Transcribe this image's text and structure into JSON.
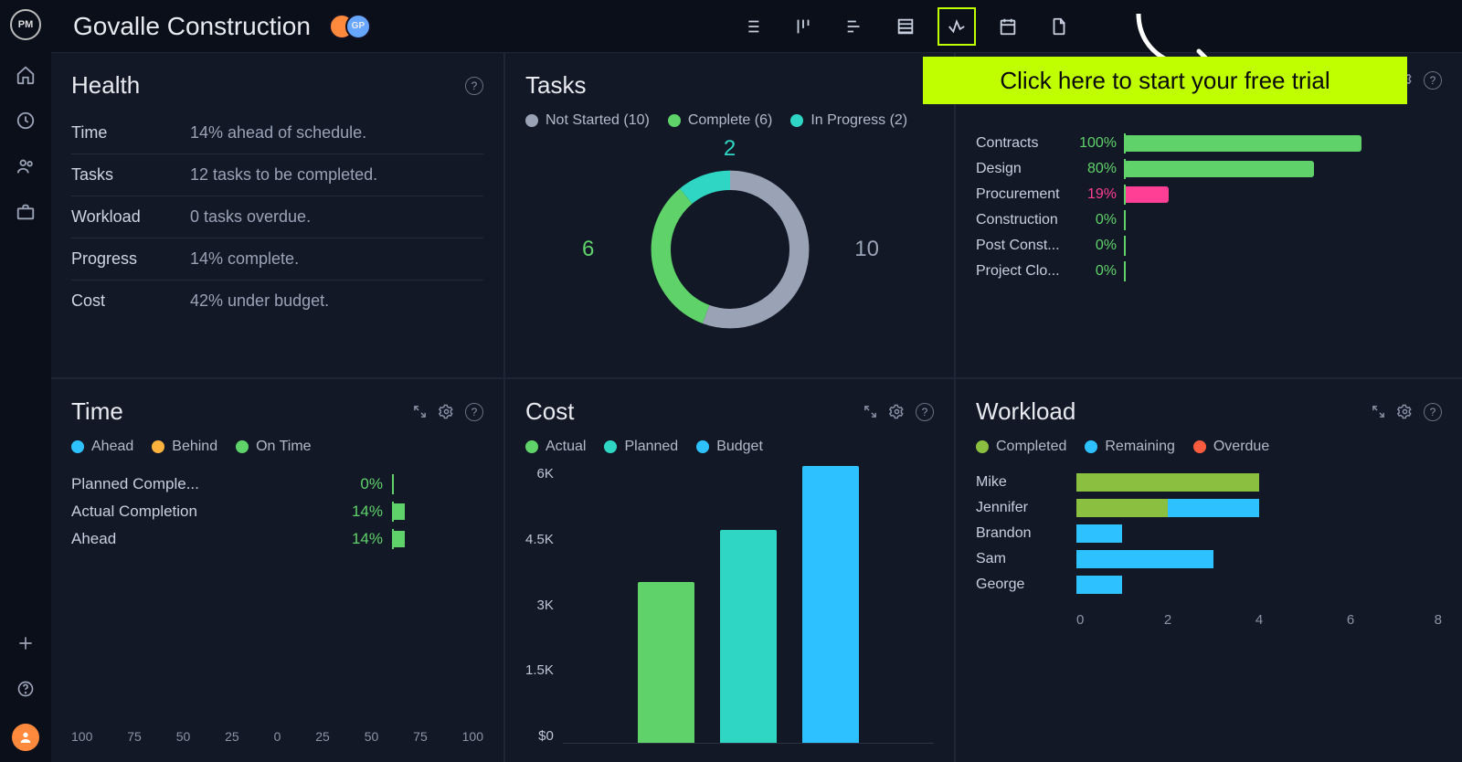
{
  "project_title": "Govalle Construction",
  "avatar_badge": "GP",
  "rail_logo": "PM",
  "cta_text": "Click here to start your free trial",
  "panels": {
    "health": {
      "title": "Health",
      "rows": [
        {
          "label": "Time",
          "value": "14% ahead of schedule."
        },
        {
          "label": "Tasks",
          "value": "12 tasks to be completed."
        },
        {
          "label": "Workload",
          "value": "0 tasks overdue."
        },
        {
          "label": "Progress",
          "value": "14% complete."
        },
        {
          "label": "Cost",
          "value": "42% under budget."
        }
      ]
    },
    "tasks": {
      "title": "Tasks",
      "legend": [
        {
          "color": "#9aa3b5",
          "label": "Not Started (10)"
        },
        {
          "color": "#5fd36a",
          "label": "Complete (6)"
        },
        {
          "color": "#2fd6c4",
          "label": "In Progress (2)"
        }
      ],
      "labels": {
        "top": "2",
        "left": "6",
        "right": "10"
      }
    },
    "progress": {
      "rows": [
        {
          "label": "Contracts",
          "pct": "100%",
          "width": 100,
          "color": "#5fd36a"
        },
        {
          "label": "Design",
          "pct": "80%",
          "width": 80,
          "color": "#5fd36a"
        },
        {
          "label": "Procurement",
          "pct": "19%",
          "width": 19,
          "color": "#ff3f95"
        },
        {
          "label": "Construction",
          "pct": "0%",
          "width": 0,
          "color": "#5fd36a"
        },
        {
          "label": "Post Const...",
          "pct": "0%",
          "width": 0,
          "color": "#5fd36a"
        },
        {
          "label": "Project Clo...",
          "pct": "0%",
          "width": 0,
          "color": "#5fd36a"
        }
      ]
    },
    "time": {
      "title": "Time",
      "legend": [
        {
          "color": "#2ec1ff",
          "label": "Ahead"
        },
        {
          "color": "#ffb23e",
          "label": "Behind"
        },
        {
          "color": "#5fd36a",
          "label": "On Time"
        }
      ],
      "rows": [
        {
          "label": "Planned Comple...",
          "pct": "0%",
          "width": 0
        },
        {
          "label": "Actual Completion",
          "pct": "14%",
          "width": 14
        },
        {
          "label": "Ahead",
          "pct": "14%",
          "width": 14
        }
      ],
      "axis": [
        "100",
        "75",
        "50",
        "25",
        "0",
        "25",
        "50",
        "75",
        "100"
      ]
    },
    "cost": {
      "title": "Cost",
      "legend": [
        {
          "color": "#5fd36a",
          "label": "Actual"
        },
        {
          "color": "#2fd6c4",
          "label": "Planned"
        },
        {
          "color": "#2ec1ff",
          "label": "Budget"
        }
      ],
      "y_ticks": [
        "6K",
        "4.5K",
        "3K",
        "1.5K",
        "$0"
      ]
    },
    "workload": {
      "title": "Workload",
      "legend": [
        {
          "color": "#8abf3f",
          "label": "Completed"
        },
        {
          "color": "#2ec1ff",
          "label": "Remaining"
        },
        {
          "color": "#ff5b3e",
          "label": "Overdue"
        }
      ],
      "rows": [
        {
          "name": "Mike"
        },
        {
          "name": "Jennifer"
        },
        {
          "name": "Brandon"
        },
        {
          "name": "Sam"
        },
        {
          "name": "George"
        }
      ],
      "axis": [
        "0",
        "2",
        "4",
        "6",
        "8"
      ]
    }
  },
  "chart_data": [
    {
      "type": "pie",
      "title": "Tasks",
      "series": [
        {
          "name": "Not Started",
          "value": 10,
          "color": "#9aa3b5"
        },
        {
          "name": "Complete",
          "value": 6,
          "color": "#5fd36a"
        },
        {
          "name": "In Progress",
          "value": 2,
          "color": "#2fd6c4"
        }
      ]
    },
    {
      "type": "bar",
      "title": "Progress",
      "categories": [
        "Contracts",
        "Design",
        "Procurement",
        "Construction",
        "Post Construction",
        "Project Closeout"
      ],
      "values": [
        100,
        80,
        19,
        0,
        0,
        0
      ],
      "ylabel": "percent"
    },
    {
      "type": "bar",
      "title": "Time",
      "categories": [
        "Planned Completion",
        "Actual Completion",
        "Ahead"
      ],
      "values": [
        0,
        14,
        14
      ],
      "ylabel": "percent",
      "xlim": [
        -100,
        100
      ]
    },
    {
      "type": "bar",
      "title": "Cost",
      "categories": [
        "Actual",
        "Planned",
        "Budget"
      ],
      "values": [
        3500,
        4650,
        6000
      ],
      "ylabel": "$",
      "ylim": [
        0,
        6000
      ]
    },
    {
      "type": "bar",
      "title": "Workload",
      "categories": [
        "Mike",
        "Jennifer",
        "Brandon",
        "Sam",
        "George"
      ],
      "series": [
        {
          "name": "Completed",
          "values": [
            4,
            2,
            0,
            0,
            0
          ]
        },
        {
          "name": "Remaining",
          "values": [
            0,
            2,
            1,
            3,
            1
          ]
        },
        {
          "name": "Overdue",
          "values": [
            0,
            0,
            0,
            0,
            0
          ]
        }
      ],
      "xlim": [
        0,
        8
      ]
    }
  ]
}
